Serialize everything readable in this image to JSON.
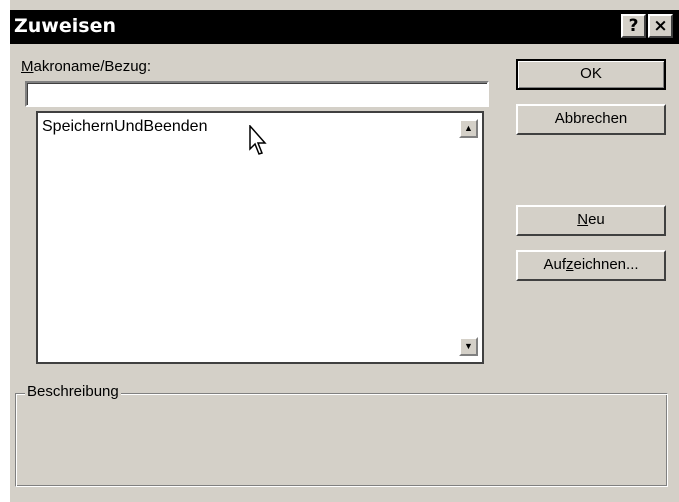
{
  "window": {
    "title": "Zuweisen",
    "help_button": "?",
    "close_button": "×"
  },
  "macro_name": {
    "label_accel": "M",
    "label_rest": "akroname/Bezug:",
    "value": ""
  },
  "macro_list": {
    "items": [
      "SpeichernUndBeenden"
    ]
  },
  "buttons": {
    "ok": "OK",
    "cancel": "Abbrechen",
    "new_accel": "N",
    "new_rest": "eu",
    "record_pre": "Auf",
    "record_accel": "z",
    "record_post": "eichnen..."
  },
  "description": {
    "label": "Beschreibung"
  }
}
